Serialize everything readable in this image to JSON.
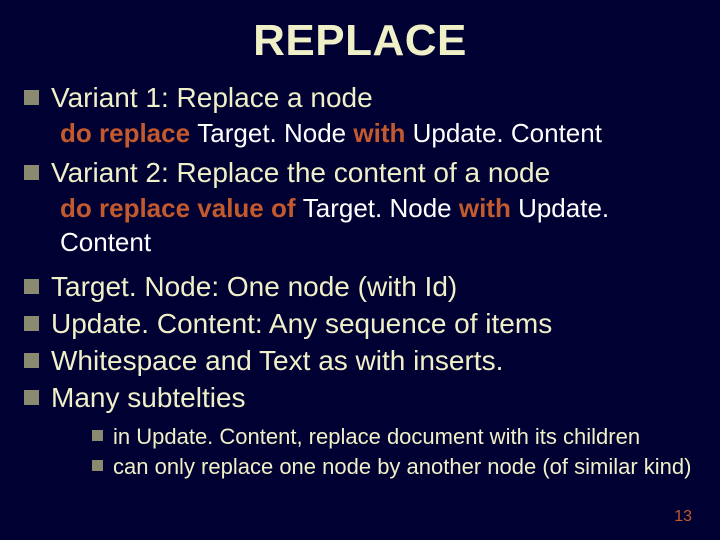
{
  "title": "REPLACE",
  "variant1": "Variant 1: Replace a node",
  "syntax1": {
    "kw1": "do replace ",
    "arg1": "Target. Node ",
    "kw2": "with ",
    "arg2": "Update. Content"
  },
  "variant2": "Variant 2: Replace the content of a node",
  "syntax2": {
    "kw1": "do replace value of ",
    "arg1": "Target. Node ",
    "kw2": "with ",
    "arg2": "Update. Content"
  },
  "b1": "Target. Node:  One node (with Id)",
  "b2": "Update. Content: Any sequence of items",
  "b3": "Whitespace and Text as with inserts.",
  "b4": "Many subtelties",
  "s1": "in Update. Content, replace document with its children",
  "s2": "can only replace one node by another node (of similar kind)",
  "pagenum": "13"
}
